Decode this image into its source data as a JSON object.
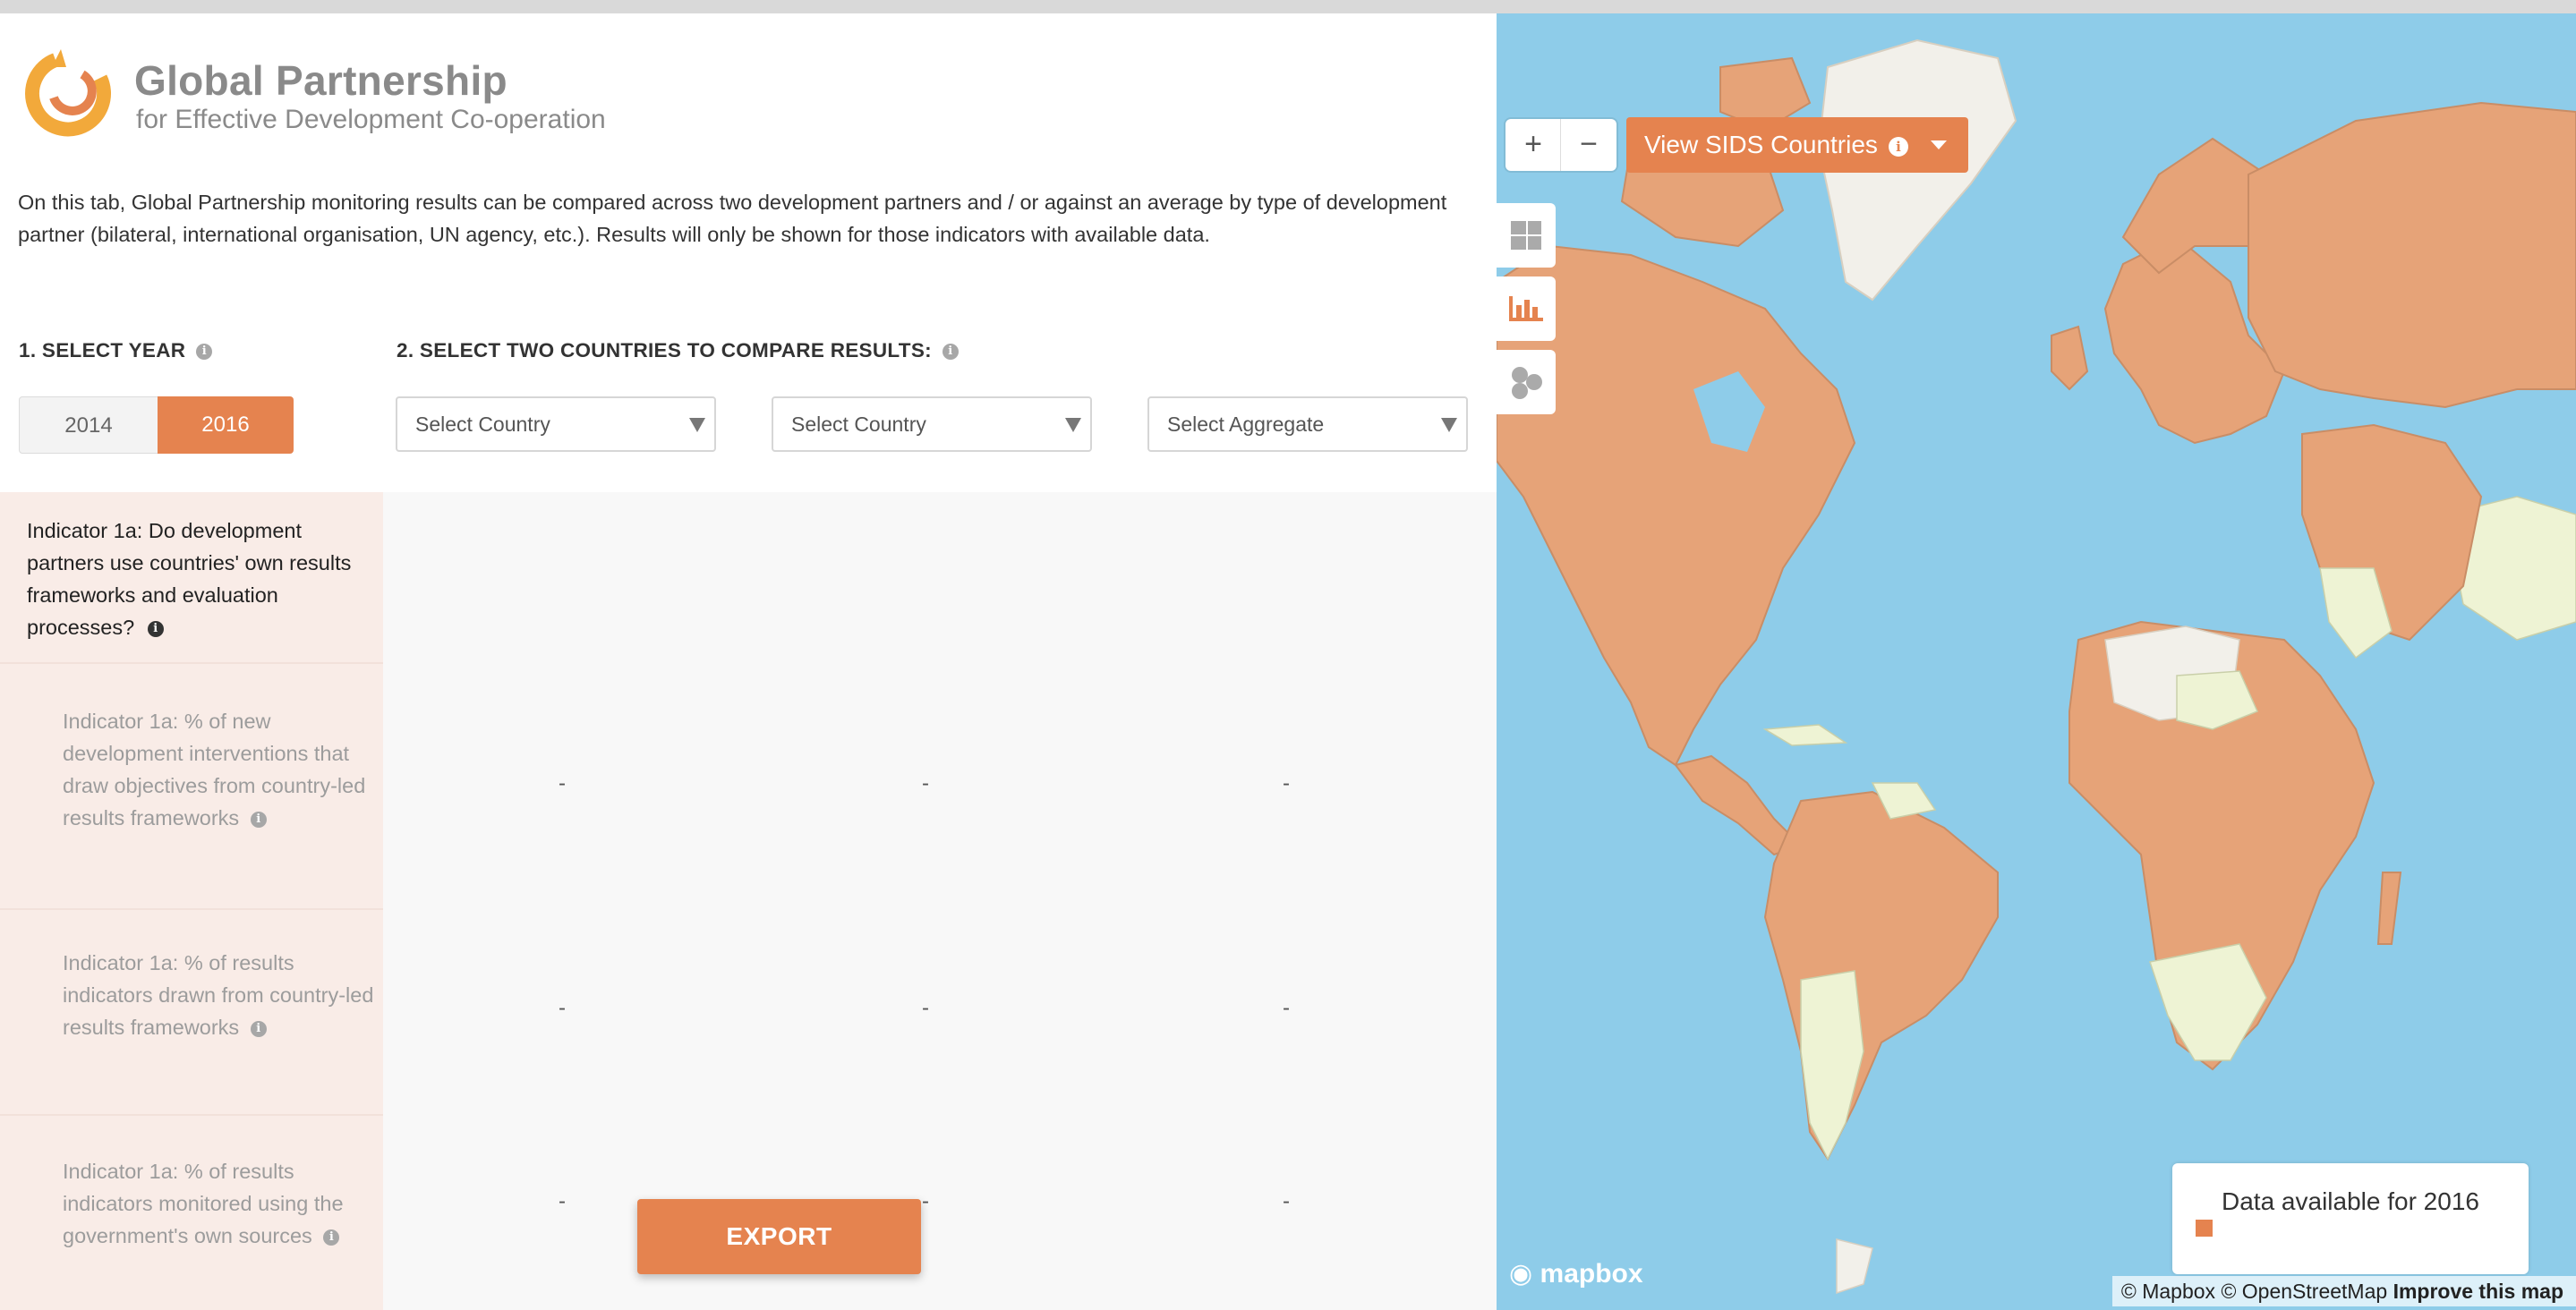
{
  "brand": {
    "title": "Global Partnership",
    "subtitle": "for Effective Development Co-operation"
  },
  "intro": "On this tab, Global Partnership monitoring results can be compared across two development partners and / or against an average by type of development partner (bilateral, international organisation, UN agency, etc.). Results will only be shown for those indicators with available data.",
  "step1": {
    "label": "1. SELECT YEAR",
    "years": [
      "2014",
      "2016"
    ],
    "selected": "2016"
  },
  "step2": {
    "label": "2. SELECT TWO COUNTRIES TO COMPARE RESULTS:",
    "select_country_1": "Select Country",
    "select_country_2": "Select Country",
    "select_aggregate": "Select Aggregate"
  },
  "info_glyph": "i",
  "indicators": {
    "main": "Indicator 1a: Do development partners use countries' own results frameworks and evaluation processes?",
    "rows": [
      {
        "label": "Indicator 1a: % of new development interventions that draw objectives from country-led results frameworks",
        "values": [
          "-",
          "-",
          "-"
        ]
      },
      {
        "label": "Indicator 1a: % of results indicators drawn from country-led results frameworks",
        "values": [
          "-",
          "-",
          "-"
        ]
      },
      {
        "label": "Indicator 1a: % of results indicators monitored using the government's own sources",
        "values": [
          "-",
          "-",
          "-"
        ]
      }
    ]
  },
  "export_label": "EXPORT",
  "map": {
    "zoom_in": "+",
    "zoom_out": "−",
    "sids_button": "View SIDS Countries",
    "legend_label": "Data available for 2016",
    "mapbox_logo": "mapbox",
    "attribution_1": "© Mapbox",
    "attribution_2": "© OpenStreetMap",
    "attribution_3": "Improve this map",
    "colors": {
      "ocean": "#8ecce9",
      "data": "#e6a378",
      "no_data": "#eef3d4",
      "greenland": "#f2f0ea",
      "accent": "#e5834f"
    },
    "side_icons": [
      "dashboard-icon",
      "bar-chart-icon",
      "cluster-icon"
    ]
  }
}
